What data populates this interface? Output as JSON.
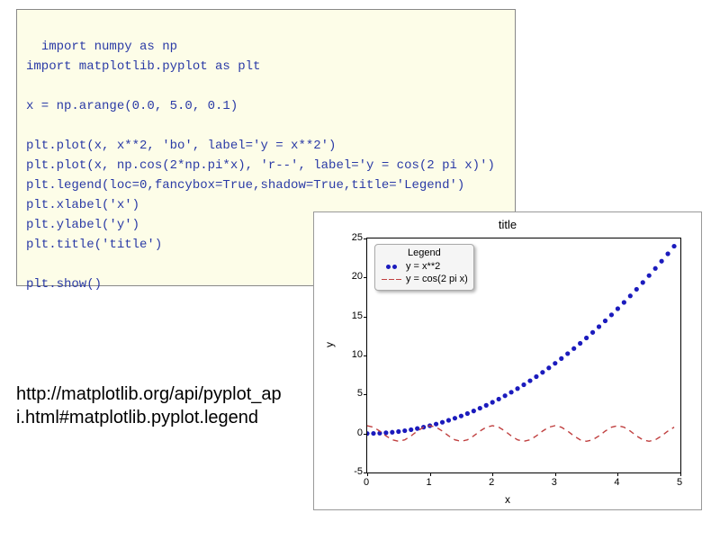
{
  "code": {
    "lines": [
      "import numpy as np",
      "import matplotlib.pyplot as plt",
      "",
      "x = np.arange(0.0, 5.0, 0.1)",
      "",
      "plt.plot(x, x**2, 'bo', label='y = x**2')",
      "plt.plot(x, np.cos(2*np.pi*x), 'r--', label='y = cos(2 pi x)')",
      "plt.legend(loc=0,fancybox=True,shadow=True,title='Legend')",
      "plt.xlabel('x')",
      "plt.ylabel('y')",
      "plt.title('title')",
      "",
      "plt.show()"
    ]
  },
  "url_text": "http://matplotlib.org/api/pyplot_ap\ni.html#matplotlib.pyplot.legend",
  "chart_data": {
    "type": "line",
    "title": "title",
    "xlabel": "x",
    "ylabel": "y",
    "xlim": [
      0,
      5
    ],
    "ylim": [
      -5,
      25
    ],
    "xticks": [
      0,
      1,
      2,
      3,
      4,
      5
    ],
    "yticks": [
      -5,
      0,
      5,
      10,
      15,
      20,
      25
    ],
    "legend": {
      "title": "Legend",
      "position": "upper-left",
      "fancybox": true,
      "shadow": true,
      "entries": [
        "y = x**2",
        "y = cos(2 pi x)"
      ]
    },
    "series": [
      {
        "name": "y = x**2",
        "style": "bo",
        "color": "#1b1bbd",
        "marker": "circle",
        "x": [
          0.0,
          0.1,
          0.2,
          0.3,
          0.4,
          0.5,
          0.6,
          0.7,
          0.8,
          0.9,
          1.0,
          1.1,
          1.2,
          1.3,
          1.4,
          1.5,
          1.6,
          1.7,
          1.8,
          1.9,
          2.0,
          2.1,
          2.2,
          2.3,
          2.4,
          2.5,
          2.6,
          2.7,
          2.8,
          2.9,
          3.0,
          3.1,
          3.2,
          3.3,
          3.4,
          3.5,
          3.6,
          3.7,
          3.8,
          3.9,
          4.0,
          4.1,
          4.2,
          4.3,
          4.4,
          4.5,
          4.6,
          4.7,
          4.8,
          4.9
        ],
        "y": [
          0.0,
          0.01,
          0.04,
          0.09,
          0.16,
          0.25,
          0.36,
          0.49,
          0.64,
          0.81,
          1.0,
          1.21,
          1.44,
          1.69,
          1.96,
          2.25,
          2.56,
          2.89,
          3.24,
          3.61,
          4.0,
          4.41,
          4.84,
          5.29,
          5.76,
          6.25,
          6.76,
          7.29,
          7.84,
          8.41,
          9.0,
          9.61,
          10.24,
          10.89,
          11.56,
          12.25,
          12.96,
          13.69,
          14.44,
          15.21,
          16.0,
          16.81,
          17.64,
          18.49,
          19.36,
          20.25,
          21.16,
          22.09,
          23.04,
          24.01
        ]
      },
      {
        "name": "y = cos(2 pi x)",
        "style": "r--",
        "color": "#c04040",
        "dash": true,
        "x": [
          0.0,
          0.1,
          0.2,
          0.3,
          0.4,
          0.5,
          0.6,
          0.7,
          0.8,
          0.9,
          1.0,
          1.1,
          1.2,
          1.3,
          1.4,
          1.5,
          1.6,
          1.7,
          1.8,
          1.9,
          2.0,
          2.1,
          2.2,
          2.3,
          2.4,
          2.5,
          2.6,
          2.7,
          2.8,
          2.9,
          3.0,
          3.1,
          3.2,
          3.3,
          3.4,
          3.5,
          3.6,
          3.7,
          3.8,
          3.9,
          4.0,
          4.1,
          4.2,
          4.3,
          4.4,
          4.5,
          4.6,
          4.7,
          4.8,
          4.9
        ],
        "y": [
          1.0,
          0.809,
          0.309,
          -0.309,
          -0.809,
          -1.0,
          -0.809,
          -0.309,
          0.309,
          0.809,
          1.0,
          0.809,
          0.309,
          -0.309,
          -0.809,
          -1.0,
          -0.809,
          -0.309,
          0.309,
          0.809,
          1.0,
          0.809,
          0.309,
          -0.309,
          -0.809,
          -1.0,
          -0.809,
          -0.309,
          0.309,
          0.809,
          1.0,
          0.809,
          0.309,
          -0.309,
          -0.809,
          -1.0,
          -0.809,
          -0.309,
          0.309,
          0.809,
          1.0,
          0.809,
          0.309,
          -0.309,
          -0.809,
          -1.0,
          -0.809,
          -0.309,
          0.309,
          0.809
        ]
      }
    ]
  }
}
